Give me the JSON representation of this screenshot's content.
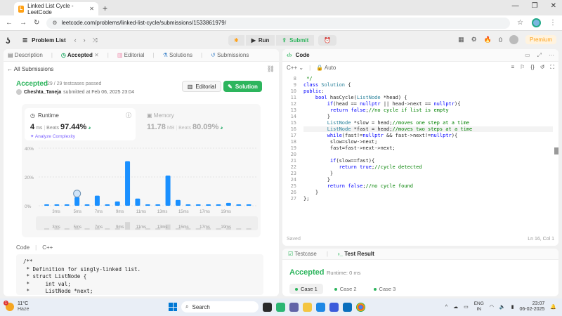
{
  "browser": {
    "tab_title": "Linked List Cycle - LeetCode",
    "url": "leetcode.com/problems/linked-list-cycle/submissions/1533861979/"
  },
  "topbar": {
    "problem_list": "Problem List",
    "run": "Run",
    "submit": "Submit",
    "coins": "0",
    "premium": "Premium"
  },
  "left_tabs": [
    "Description",
    "Accepted",
    "Editorial",
    "Solutions",
    "Submissions"
  ],
  "submission": {
    "back": "All Submissions",
    "status": "Accepted",
    "passed": "29 / 29 testcases passed",
    "author": "Cheshta_Taneja",
    "submitted": "submitted at Feb 06, 2025 23:04",
    "editorial_btn": "Editorial",
    "solution_btn": "Solution"
  },
  "runtime": {
    "label": "Runtime",
    "value": "4",
    "unit": "ms",
    "beats_label": "Beats",
    "beats": "97.44%",
    "analyze": "Analyze Complexity"
  },
  "memory": {
    "label": "Memory",
    "value": "11.78",
    "unit": "MB",
    "beats_label": "Beats",
    "beats": "80.09%"
  },
  "chart_data": {
    "type": "bar",
    "ylabels": [
      "40%",
      "20%",
      "0%"
    ],
    "ylim": [
      0,
      40
    ],
    "x_ticks": [
      "3ms",
      "5ms",
      "7ms",
      "9ms",
      "11ms",
      "13ms",
      "15ms",
      "17ms",
      "19ms"
    ],
    "values": [
      1,
      1,
      1,
      6,
      1,
      7,
      1,
      3,
      31,
      5,
      1,
      1,
      21,
      4,
      1,
      1,
      1,
      1,
      2,
      1,
      1
    ],
    "highlight_index": 3,
    "color": "#1a90ff"
  },
  "code_section": {
    "label": "Code",
    "lang": "C++",
    "lines": [
      "/**",
      " * Definition for singly-linked list.",
      " * struct ListNode {",
      " *     int val;",
      " *     ListNode *next;"
    ]
  },
  "editor": {
    "title": "Code",
    "lang": "C++",
    "mode": "Auto",
    "saved": "Saved",
    "cursor": "Ln 16, Col 1",
    "lines": [
      {
        "n": "8",
        "t": " */"
      },
      {
        "n": "9",
        "t": "class Solution {"
      },
      {
        "n": "10",
        "t": "public:"
      },
      {
        "n": "11",
        "t": "    bool hasCycle(ListNode *head) {"
      },
      {
        "n": "12",
        "t": "        if(head == nullptr || head->next == nullptr){"
      },
      {
        "n": "13",
        "t": "         return false;//no cycle if list is empty"
      },
      {
        "n": "14",
        "t": "        }"
      },
      {
        "n": "15",
        "t": "        ListNode *slow = head;//moves one step at a time"
      },
      {
        "n": "16",
        "t": "        ListNode *fast = head;//moves two steps at a time"
      },
      {
        "n": "17",
        "t": "        while(fast!=nullptr && fast->next!=nullptr){"
      },
      {
        "n": "18",
        "t": "         slow=slow->next;"
      },
      {
        "n": "19",
        "t": "         fast=fast->next->next;"
      },
      {
        "n": "20",
        "t": ""
      },
      {
        "n": "21",
        "t": "         if(slow==fast){"
      },
      {
        "n": "22",
        "t": "            return true;//cycle detected"
      },
      {
        "n": "23",
        "t": "         }"
      },
      {
        "n": "24",
        "t": "        }"
      },
      {
        "n": "25",
        "t": "        return false;//no cycle found"
      },
      {
        "n": "26",
        "t": "    }"
      },
      {
        "n": "27",
        "t": "};"
      }
    ]
  },
  "result": {
    "testcase_tab": "Testcase",
    "result_tab": "Test Result",
    "status": "Accepted",
    "runtime": "Runtime: 0 ms",
    "cases": [
      "Case 1",
      "Case 2",
      "Case 3"
    ]
  },
  "taskbar": {
    "temp": "11°C",
    "weather": "Haze",
    "badge": "1",
    "search": "Search",
    "lang1": "ENG",
    "lang2": "IN",
    "time": "23:07",
    "date": "06-02-2025"
  }
}
